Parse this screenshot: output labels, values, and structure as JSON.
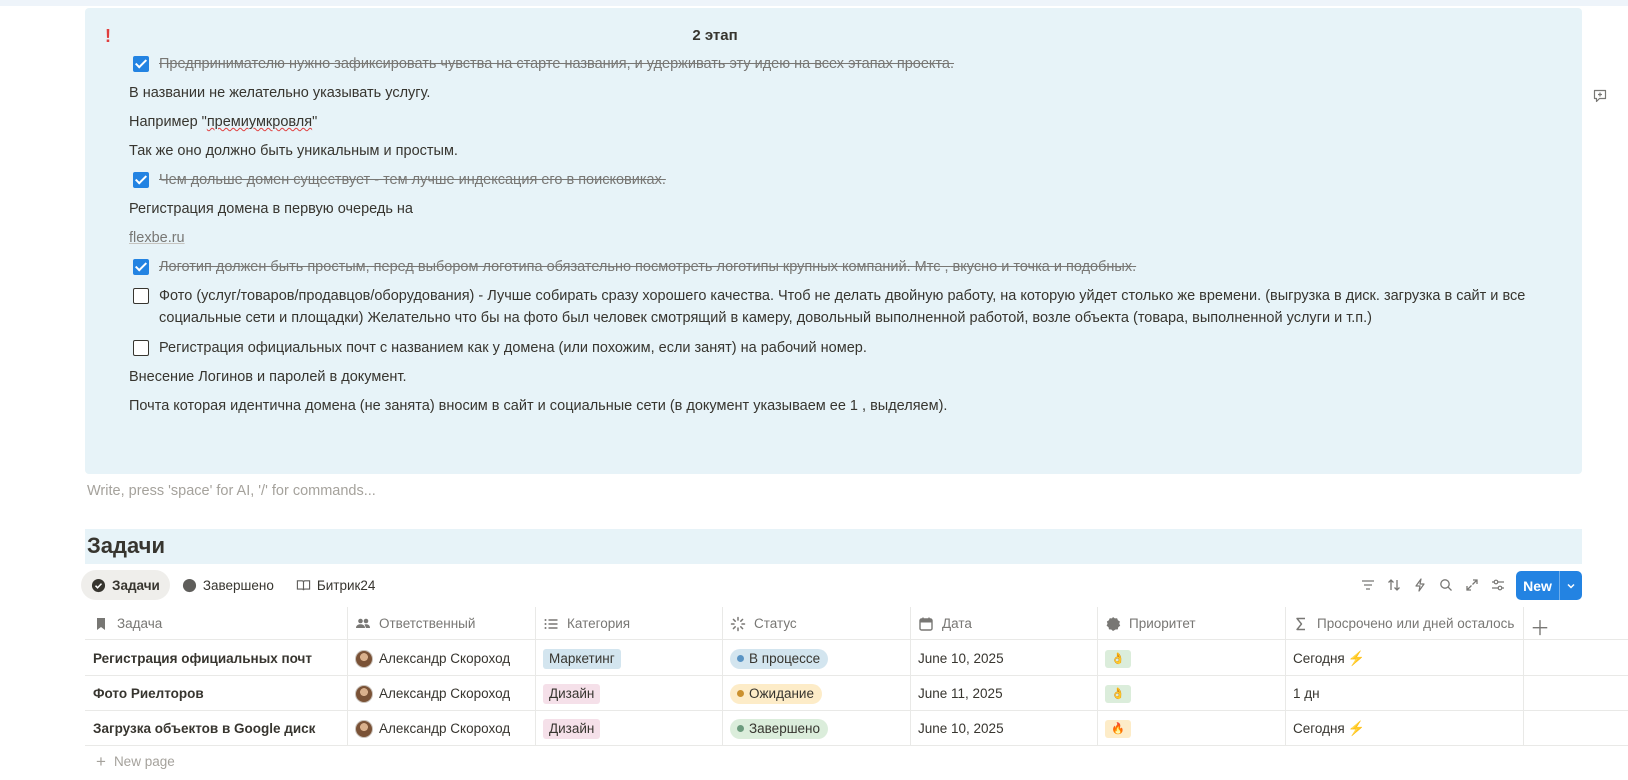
{
  "callout": {
    "marker": "!",
    "heading": "2 этап",
    "lines": {
      "l1": "Предпринимателю нужно зафиксировать чувства на старте названия, и удерживать эту идею на всех этапах проекта.",
      "l2": "В названии не желательно указывать услугу.",
      "l3_prefix": "Например \"",
      "l3_word": "премиумкровля",
      "l3_suffix": "\"",
      "l4": "Так же оно должно быть уникальным и простым.",
      "l5": "Чем дольше домен существует - тем лучше индексация его в поисковиках.",
      "l6": "Регистрация домена в первую очередь на",
      "l7": "flexbe.ru",
      "l8": "Логотип должен быть простым, перед выбором логотипа обязательно посмотреть логотипы крупных компаний. Мтс , вкусно и точка и подобных.",
      "l9": "Фото (услуг/товаров/продавцов/оборудования) - Лучше собирать сразу хорошего качества. Чтоб не делать двойную работу, на которую уйдет столько же времени. (выгрузка в диск. загрузка в сайт и все социальные сети и площадки) Желательно что бы на фото был человек смотрящий в камеру, довольный выполненной работой, возле объекта (товара, выполненной услуги и т.п.)",
      "l10": "Регистрация официальных почт с названием как у домена (или похожим, если занят) на рабочий номер.",
      "l11": "Внесение Логинов и паролей в документ.",
      "l12": "Почта которая идентична домена (не занята) вносим в сайт и социальные сети (в документ указываем ее 1 , выделяем)."
    },
    "checked": [
      true,
      true,
      true,
      false,
      false
    ]
  },
  "editor": {
    "placeholder": "Write, press 'space' for AI, '/' for commands..."
  },
  "database": {
    "title": "Задачи",
    "tabs": [
      "Задачи",
      "Завершено",
      "Битрик24"
    ],
    "new_label": "New",
    "columns": [
      "Задача",
      "Ответственный",
      "Категория",
      "Статус",
      "Дата",
      "Приоритет",
      "Просрочено или дней осталось"
    ],
    "rows": [
      {
        "task": "Регистрация официальных почт",
        "owner": "Александр Скороход",
        "category": "Маркетинг",
        "status": "В процессе",
        "date": "June 10, 2025",
        "priority": "👌",
        "remaining": "Сегодня",
        "bolt": "⚡"
      },
      {
        "task": "Фото Риелторов",
        "owner": "Александр Скороход",
        "category": "Дизайн",
        "status": "Ожидание",
        "date": "June 11, 2025",
        "priority": "👌",
        "remaining": "1 дн",
        "bolt": ""
      },
      {
        "task": "Загрузка объектов в Google диск",
        "owner": "Александр Скороход",
        "category": "Дизайн",
        "status": "Завершено",
        "date": "June 10, 2025",
        "priority": "🔥",
        "remaining": "Сегодня",
        "bolt": "⚡"
      }
    ],
    "new_page": "New page"
  },
  "colors": {
    "accent": "#2383e2",
    "callout_bg": "#e7f3f8",
    "tag_marketing": "#d3e5ef",
    "tag_design": "#f5e0e9",
    "status_inprogress": "#d3e5ef",
    "status_waiting": "#fdecc8",
    "status_done": "#dbeddb"
  }
}
